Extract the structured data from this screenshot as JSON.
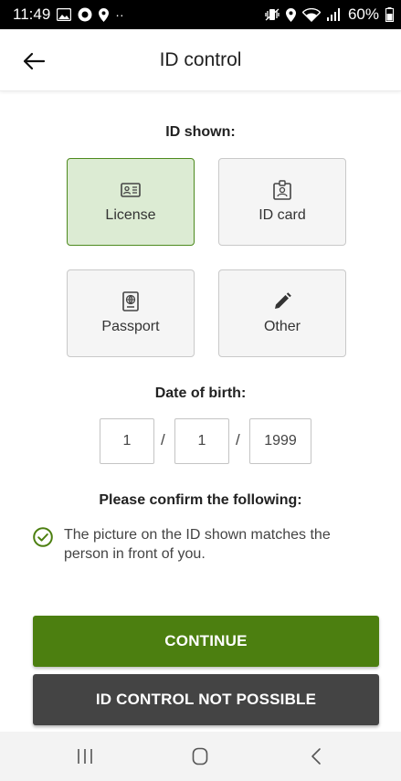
{
  "status_bar": {
    "time": "11:49",
    "dots": "··",
    "battery": "60%"
  },
  "app_bar": {
    "title": "ID control"
  },
  "id_shown": {
    "label": "ID shown:",
    "options": [
      {
        "label": "License",
        "icon": "license-icon",
        "selected": true
      },
      {
        "label": "ID card",
        "icon": "id-card-icon",
        "selected": false
      },
      {
        "label": "Passport",
        "icon": "passport-icon",
        "selected": false
      },
      {
        "label": "Other",
        "icon": "pencil-icon",
        "selected": false
      }
    ]
  },
  "dob": {
    "label": "Date of birth:",
    "day": "1",
    "month": "1",
    "year": "1999",
    "separator": "/"
  },
  "confirm": {
    "label": "Please confirm the following:",
    "item_text": "The picture on the ID shown matches the person in front of you.",
    "checked": true
  },
  "buttons": {
    "continue": "CONTINUE",
    "not_possible": "ID CONTROL NOT POSSIBLE"
  },
  "colors": {
    "accent": "#4c7f10",
    "selected_bg": "#dcebd3",
    "dark_button": "#444444"
  }
}
